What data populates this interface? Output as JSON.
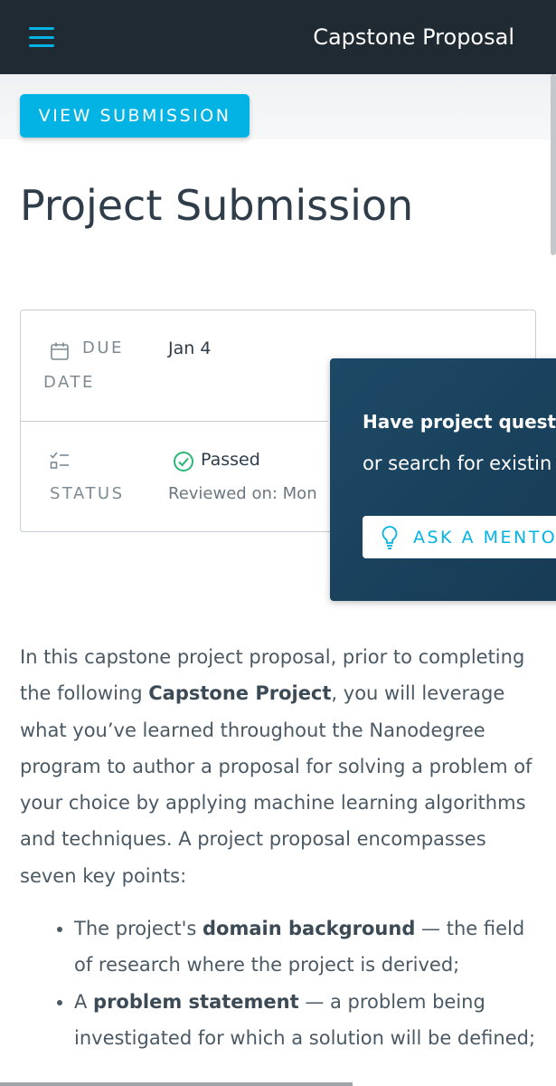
{
  "header": {
    "title": "Capstone Proposal",
    "menu_icon": "hamburger-menu-icon"
  },
  "actions": {
    "view_submission": "VIEW SUBMISSION"
  },
  "page": {
    "title": "Project Submission"
  },
  "details": {
    "due_label_1": "DUE",
    "due_label_2": "DATE",
    "due_value": "Jan 4",
    "status_label": "STATUS",
    "status_value": "Passed",
    "reviewed": "Reviewed on: Mon"
  },
  "help_popup": {
    "heading": "Have project questio",
    "subtext": "or search for existin",
    "button": "ASK A MENTO"
  },
  "body": {
    "intro_1": "In this capstone project proposal, prior to completing the following ",
    "intro_bold": "Capstone Project",
    "intro_2": ", you will leverage what you’ve learned throughout the Nanodegree program to author a proposal for solving a problem of your choice by applying machine learning algorithms and techniques. A project proposal encompasses seven key points:",
    "bullets": [
      {
        "pre": "The project's ",
        "bold": "domain background",
        "post": " — the field of research where the project is derived;"
      },
      {
        "pre": "A ",
        "bold": "problem statement",
        "post": " — a problem being investigated for which a solution will be defined;"
      }
    ]
  },
  "colors": {
    "accent": "#02b3e4",
    "topbar": "#1f2a33",
    "popup": "#1d4966",
    "success": "#2ab673"
  }
}
